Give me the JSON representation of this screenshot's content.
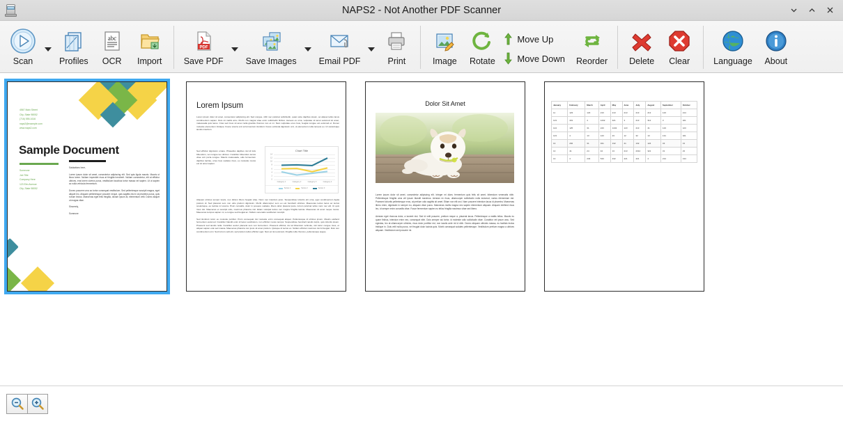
{
  "window": {
    "title": "NAPS2 - Not Another PDF Scanner",
    "app_icon": "scanner-icon",
    "controls": [
      {
        "name": "minimize",
        "glyph": "chevron-down-icon"
      },
      {
        "name": "maximize",
        "glyph": "chevron-up-icon"
      },
      {
        "name": "close",
        "glyph": "close-icon"
      }
    ]
  },
  "toolbar": {
    "items": [
      {
        "label": "Scan",
        "icon": "scan-play-icon",
        "dropdown": true
      },
      {
        "label": "Profiles",
        "icon": "profiles-icon",
        "dropdown": false
      },
      {
        "label": "OCR",
        "icon": "ocr-abc-icon",
        "dropdown": false
      },
      {
        "label": "Import",
        "icon": "import-folder-icon",
        "dropdown": false
      },
      {
        "label": "Save PDF",
        "icon": "pdf-file-icon",
        "dropdown": true
      },
      {
        "label": "Save Images",
        "icon": "images-icon",
        "dropdown": true
      },
      {
        "label": "Email PDF",
        "icon": "email-attach-icon",
        "dropdown": true
      },
      {
        "label": "Print",
        "icon": "printer-icon",
        "dropdown": false
      },
      {
        "label": "Image",
        "icon": "image-edit-icon",
        "dropdown": false
      },
      {
        "label": "Rotate",
        "icon": "rotate-icon",
        "dropdown": false
      },
      {
        "label": "Move Up",
        "icon": "arrow-up-icon",
        "dropdown": false
      },
      {
        "label": "Move Down",
        "icon": "arrow-down-icon",
        "dropdown": false
      },
      {
        "label": "Reorder",
        "icon": "reorder-icon",
        "dropdown": false
      },
      {
        "label": "Delete",
        "icon": "delete-x-icon",
        "dropdown": false
      },
      {
        "label": "Clear",
        "icon": "clear-octagon-icon",
        "dropdown": false
      },
      {
        "label": "Language",
        "icon": "globe-icon",
        "dropdown": false
      },
      {
        "label": "About",
        "icon": "info-icon",
        "dropdown": false
      }
    ]
  },
  "bottom_bar": {
    "zoom_out_label": "Zoom out",
    "zoom_in_label": "Zoom in",
    "zoom_out_icon": "magnifier-minus-icon",
    "zoom_in_icon": "magnifier-plus-icon"
  },
  "thumbnails": {
    "selected_index": 0,
    "selection_color": "#3fa9f0",
    "pages": [
      {
        "name": "page-1",
        "kind": "sample-document"
      },
      {
        "name": "page-2",
        "kind": "lorem-ipsum"
      },
      {
        "name": "page-3",
        "kind": "dolor-sit-amet"
      },
      {
        "name": "page-4",
        "kind": "data-table"
      }
    ]
  },
  "page1": {
    "title": "Sample Document",
    "header_lines": "4567 Main Street\nCity, State 98052\n(716) 555-1616\nnaps2@example.com\nwww.naps2.com",
    "meta_lines": "Someone\nJob Title\nCompany Here\n123 Elm Avenue\nCity, State 98052",
    "salutation": "Salutations here,",
    "para1": "Lorem ipsum dolor sit amet, consectetur adipiscing elit. Sed quis ligula mauris. Mauris ut litora lorem. Nullam imperdiet risus at fringilla hendrerit. Nullam consectetur, elit at efficitur ultrices, erat lorem viverra purus, vestibulum faucibus tortor massa vel sapien. Ut ut sapien ac nulla vehicula fermentum.",
    "para2": "Donec posuere urna ac tortor consequat vestibulum. Sed pellentesque suscipit magna, eget aliquet leo. Aliquam pellentesque posuere neque, quis sagittis nisi in at pharetra purus, quis rutrum lectus. Maecenas eget felis fringilla, dictum ipsum at, elementum velit. Donec aliquet ut magna vitae.",
    "closing": "Sincerely,",
    "signature": "Someone",
    "accent_colors": {
      "green": "#6aa84f",
      "teal": "#3e8e9e",
      "yellow": "#f5d347"
    }
  },
  "page2": {
    "title": "Lorem Ipsum",
    "para1": "Lorem ipsum dolor sit amet, consectetur adipiscing elit. Sed congue, nibh nec pulvinar sollicitudin, quam ante dapibus ipsum, ac aliquet tellus lacus condimentum sapien. Duis sit mattis arcu. Morbi non magna vitae enim sollicitudin finibus. Aenean ex urna, vulputate sit amet euismod sit amet, malesuada quis lacus. Cras sed risus sit amet nulla gravida rhoncus non et mi. Nam vulputate eros risus, feugiat congue est euismod et. Donec molestie elementum tristique. Fusce viverra orci at fermentum tincidunt. Fusce vehicula dignissim orci, ut elementum nulla tempus eu. Ut scelerisque iaculis interdum.",
    "para2": "Sed efficitur dignissim ornare. Phasellus dapibus nisl id felis bibendum, vel congue leo ultrices. Curabitur bibendum lectus vitae orci porta congue. Mauris malesuada, odio fermentum dapibus lacinia, urna risus sodales risus, eu molestie metus est sit amet sapien.",
    "para3": "Aliquam ultrices tempor turpis, nec dictum libero feugiat vitae. Nunc nec interdum justo. Suspendisse lobortis elit urna, eget condimentum ligula pretium id. Sed placerat sem non odio pretium dignissim. Morbi ullamcorper sem eu est hendrerit ultricies. Maecenas lectus lacus ac lectus scelerisque, eu lacinia mi viverra. Proin convallis, dolor in posuere sodales, libero dolor placerat justo, rutrum pulvinar tellus nunc nec elit. Ut quis risus dui. Maecenas et suscipit odio, maximus pharetra nisl. Etiam volutpat lectus nec magna fringilla lacinia. Maecenas sit amet neque metus. Maecenas tempus sapien mi, a congue sed feugiat ac. Nullam venenatis vestibulum suscipit.",
    "para4": "Sed tincidunt tortor eu molestie porttitor. Proin consequat nisl molestie enim consequat aliquet. Pellentesque id ultrices ipsum. Mauris eleifend fermentum euismod. Curabitur blandit enim id lacus vestibulum, non efficitur metus tempor. Suspendisse hendrerit iaculis turpis, quis lobortis ipsum. Praesent sed iaculis nulla. Curabitur auctor placerat sem non fermentum. Praesent efficitur, dui at bibendum vehicula, nisl tortor congue risus, et aliquet sapien erat sed massa. Maecenas pharetra non justo sit amet pretium. Quisque id lectus ex. Nullam efficitur maximus nisl id feugiat. Duis non condimentum orci. Sed rutrum velit elit, sed pretium tellus efficitur eget. Nam at nisi euismod, fringilla nulla rhoncus, pellentesque augue."
  },
  "page3": {
    "title": "Dolor Sit Amet",
    "image_alt": "puppy-photo",
    "para1": "Lorem ipsum dolor sit amet, consectetur adipiscing elit. Integer mi diam, fermentum quis felis sit amet, bibendum venenatis nibh. Pellentesque fringilla urna vel ipsum blandit maximus. Aenean ex risus, ullamcorper sollicitudin nulla euismod, varius elementum est. Praesent lobortis pellentesque eros, at pretium odio sagittis sit amet. Etiam non elit orci. Nam posuere interdum lacus id pharetra. Maecenas libero enim, dignissim in semper eu, aliquam vitae purus. Maecenas mollis magna nec sapien elementum aliquam. Aliquam eleifend risus leo, id semper enim convallis vitae. Fusce fermentum sapien eu tellus fringilla maximus vitae sed libero.",
    "para2": "Aenean eget rhoncus dolor, a laoreet nisl. Sed id velit posuere, pretium neque a, placerat lacus. Pellentesque a mattis tellus. Mauris eu quam finibus, interdum enim nec, consequat nibh. Duis semper dui tortor, id molestie odio sollicitudin vitae. Curabitur vel ipsum arcu. Sed egestas, leo at ullamcorper ultricies, risus dolor porttitor est, non iaculis ante mi id nibh. Donec aliquam ultricies massa, eu facilisis lectus tristique in. Duis velit nulla purus, vel feugiat dolor lacinia quis. Morbi consequat sodales pellentesque. Vestibulum pretium magna a ultrices aliquam. Vestibulum sed posuere mi."
  },
  "page4": {
    "columns": [
      "January",
      "February",
      "March",
      "April",
      "May",
      "June",
      "July",
      "August",
      "September",
      "October"
    ],
    "rows": [
      [
        "11",
        "123",
        "123",
        "213",
        "213",
        "213",
        "213",
        "213",
        "123",
        "214"
      ],
      [
        "123",
        "431",
        "4",
        "1232",
        "321",
        "3",
        "213",
        "312",
        "3",
        "321"
      ],
      [
        "124",
        "125",
        "31",
        "243",
        "1432",
        "123",
        "213",
        "41",
        "123",
        "123"
      ],
      [
        "123",
        "4",
        "13",
        "123",
        "23",
        "12",
        "32",
        "13",
        "131",
        "321"
      ],
      [
        "13",
        "202",
        "31",
        "321",
        "132",
        "41",
        "132",
        "124",
        "43",
        "13"
      ],
      [
        "13",
        "41",
        "24",
        "42",
        "13",
        "213",
        "2312",
        "321",
        "31",
        "23"
      ],
      [
        "13",
        "4",
        "234",
        "543",
        "432",
        "421",
        "421",
        "4",
        "214",
        "134"
      ]
    ]
  },
  "chart_data": {
    "type": "line",
    "title": "Chart Title",
    "xlabel": "",
    "ylabel": "",
    "categories": [
      "Category 1",
      "Category 2",
      "Category 3",
      "Category 4"
    ],
    "series": [
      {
        "name": "Series 1",
        "values": [
          4.3,
          2.5,
          3.5,
          4.5
        ],
        "color": "#9ed3e6"
      },
      {
        "name": "Series 2",
        "values": [
          6.0,
          6.2,
          4.4,
          6.5
        ],
        "color": "#f5d347"
      },
      {
        "name": "Series 3",
        "values": [
          8.0,
          8.2,
          7.8,
          12.0
        ],
        "color": "#2e7d96"
      }
    ],
    "ylim": [
      0,
      14
    ],
    "yticks": [
      0,
      2,
      4,
      6,
      8,
      10,
      12,
      14
    ],
    "grid": true,
    "legend_position": "bottom"
  }
}
